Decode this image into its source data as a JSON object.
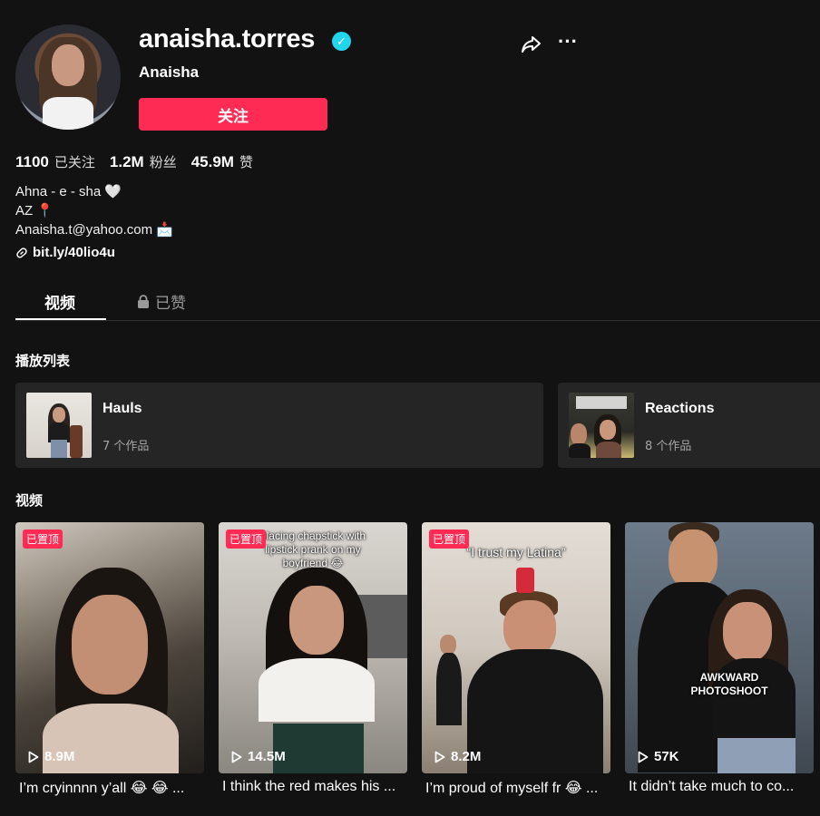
{
  "profile": {
    "username": "anaisha.torres",
    "display_name": "Anaisha",
    "follow_label": "关注",
    "stats": [
      {
        "value": "1100",
        "label": "已关注"
      },
      {
        "value": "1.2M",
        "label": "粉丝"
      },
      {
        "value": "45.9M",
        "label": "赞"
      }
    ],
    "bio": [
      "Ahna - e - sha 🤍",
      "AZ 📍",
      "Anaisha.t@yahoo.com 📩"
    ],
    "link": "bit.ly/40lio4u"
  },
  "tabs": {
    "videos": "视频",
    "liked": "已赞"
  },
  "sections": {
    "playlists": "播放列表",
    "videos": "视频"
  },
  "playlists": [
    {
      "title": "Hauls",
      "count": "7 个作品"
    },
    {
      "title": "Reactions",
      "count": "8 个作品"
    }
  ],
  "videos": [
    {
      "pinned": "已置顶",
      "views": "8.9M",
      "caption": "I’m cryinnnn y’all 😂 😂 ...",
      "overlay": ""
    },
    {
      "pinned": "已置顶",
      "views": "14.5M",
      "caption": "I think the red makes his ...",
      "overlay": "placing chapstick with lipstick prank on my boyfriend 😂"
    },
    {
      "pinned": "已置顶",
      "views": "8.2M",
      "caption": "I’m proud of myself fr 😂 ...",
      "overlay": "“I trust my Latina”"
    },
    {
      "pinned": "",
      "views": "57K",
      "caption": "It didn’t take much to co...",
      "overlay": "AWKWARD PHOTOSHOOT"
    }
  ],
  "colors": {
    "accent": "#fe2c55",
    "verified": "#20d5ec",
    "background": "#121212"
  },
  "icons": [
    "verified-badge-icon",
    "share-icon",
    "more-icon",
    "link-icon",
    "lock-icon",
    "play-icon"
  ]
}
